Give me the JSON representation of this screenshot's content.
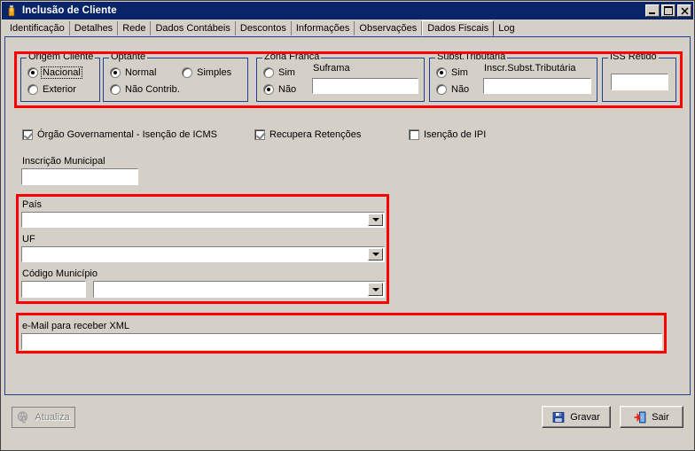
{
  "window": {
    "title": "Inclusão de Cliente",
    "icon": "user-icon",
    "controls": {
      "minimize": "_",
      "maximize": "▫",
      "close": "✕"
    }
  },
  "tabs": [
    {
      "label": "Identificação",
      "active": false
    },
    {
      "label": "Detalhes",
      "active": false
    },
    {
      "label": "Rede",
      "active": false
    },
    {
      "label": "Dados Contábeis",
      "active": false
    },
    {
      "label": "Descontos",
      "active": false
    },
    {
      "label": "Informações",
      "active": false
    },
    {
      "label": "Observações",
      "active": false
    },
    {
      "label": "Dados Fiscais",
      "active": true
    },
    {
      "label": "Log",
      "active": false
    }
  ],
  "groups": {
    "origem_cliente": {
      "title": "Origem Cliente",
      "options": [
        {
          "label": "Nacional",
          "selected": true,
          "focused": true
        },
        {
          "label": "Exterior",
          "selected": false,
          "focused": false
        }
      ]
    },
    "optante": {
      "title": "Optante",
      "options": [
        {
          "label": "Normal",
          "selected": true
        },
        {
          "label": "Simples",
          "selected": false
        },
        {
          "label": "Não Contrib.",
          "selected": false
        }
      ]
    },
    "zona_franca": {
      "title": "Zona Franca",
      "options": [
        {
          "label": "Sim",
          "selected": false
        },
        {
          "label": "Não",
          "selected": true
        }
      ],
      "suframa_label": "Suframa",
      "suframa_value": ""
    },
    "subst_tributaria": {
      "title": "Subst.Tributária",
      "options": [
        {
          "label": "Sim",
          "selected": true
        },
        {
          "label": "Não",
          "selected": false
        }
      ],
      "inscr_label": "Inscr.Subst.Tributária",
      "inscr_value": ""
    },
    "iss_retido": {
      "title": "ISS Retido",
      "value": ""
    }
  },
  "checkboxes": [
    {
      "label": "Órgão Governamental - Isenção de ICMS",
      "checked": true,
      "disabled": true
    },
    {
      "label": "Recupera Retenções",
      "checked": true,
      "disabled": true
    },
    {
      "label": "Isenção de IPI",
      "checked": false,
      "disabled": false
    }
  ],
  "fields": {
    "inscricao_municipal": {
      "label": "Inscrição Municipal",
      "value": ""
    },
    "pais": {
      "label": "País",
      "value": ""
    },
    "uf": {
      "label": "UF",
      "value": ""
    },
    "codigo_municipio": {
      "label": "Código Município",
      "code_value": "",
      "name_value": ""
    },
    "email_xml": {
      "label": "e-Mail para receber XML",
      "value": ""
    }
  },
  "buttons": {
    "atualiza": {
      "label": "Atualiza",
      "icon": "refresh-globe-icon",
      "disabled": true
    },
    "gravar": {
      "label": "Gravar",
      "icon": "floppy-save-icon",
      "disabled": false
    },
    "sair": {
      "label": "Sair",
      "icon": "exit-door-icon",
      "disabled": false
    }
  },
  "annotations": {
    "color": "#ff0000",
    "boxes": [
      {
        "name": "top-groups-highlight"
      },
      {
        "name": "location-fields-highlight"
      },
      {
        "name": "email-xml-highlight"
      }
    ]
  },
  "colors": {
    "titlebar": "#0a246a",
    "face": "#d4d0c8",
    "panel_border": "#1f3f8f",
    "annotation": "#ff0000"
  }
}
